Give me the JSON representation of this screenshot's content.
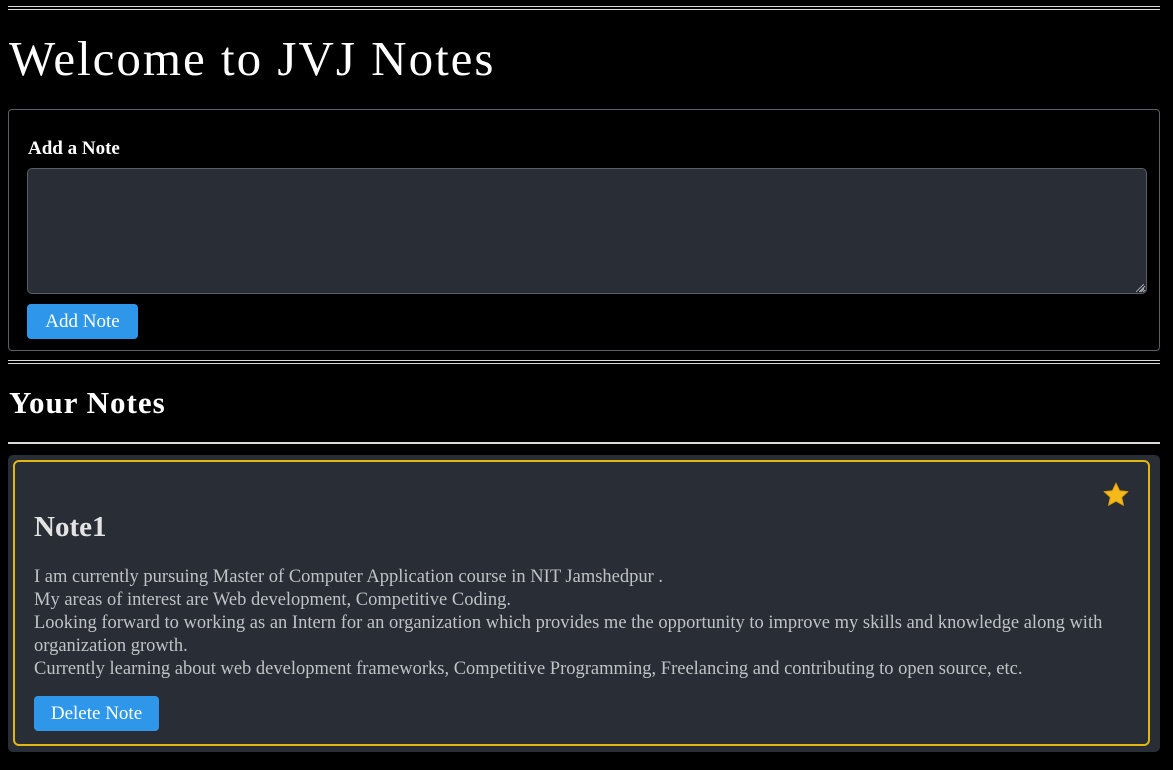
{
  "page": {
    "title": "Welcome to JVJ Notes"
  },
  "add_note": {
    "label": "Add a Note",
    "input_value": "",
    "button_label": "Add Note"
  },
  "notes_section": {
    "title": "Your Notes",
    "notes": [
      {
        "title": "Note1",
        "starred": true,
        "star_icon": "star-icon",
        "body_lines": [
          "I am currently pursuing Master of Computer Application course in NIT Jamshedpur .",
          "My areas of interest are Web development, Competitive Coding.",
          "Looking forward to working as an Intern for an organization which provides me the opportunity to improve my skills and knowledge along with organization growth.",
          "Currently learning about web development frameworks, Competitive Programming, Freelancing and contributing to open source, etc."
        ],
        "delete_label": "Delete Note"
      }
    ]
  },
  "colors": {
    "background": "#000000",
    "panel": "#292d35",
    "accent_button": "#2f97ea",
    "note_border": "#e2b714",
    "star": "#f5b91a"
  }
}
